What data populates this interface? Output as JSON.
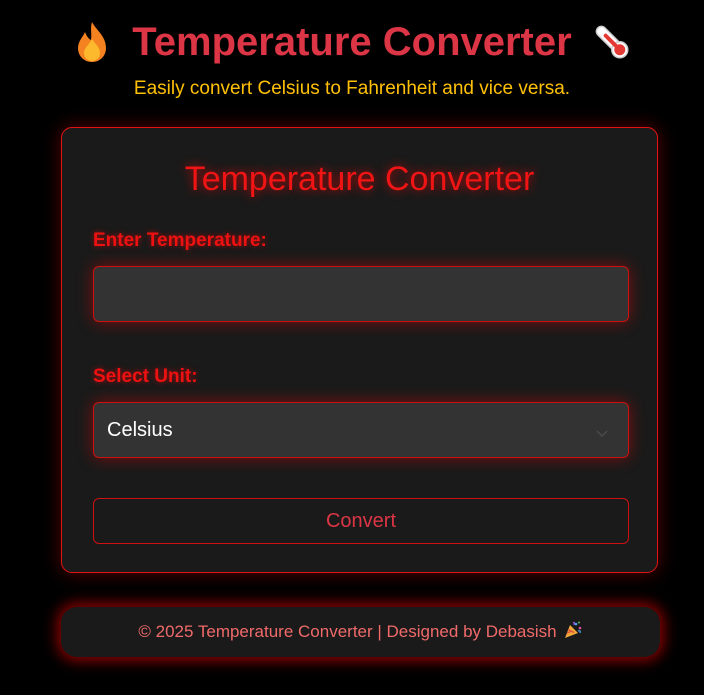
{
  "header": {
    "title": "Temperature Converter",
    "title_left_icon": "fire-icon",
    "title_right_icon": "thermometer-icon",
    "subtitle": "Easily convert Celsius to Fahrenheit and vice versa."
  },
  "card": {
    "title": "Temperature Converter",
    "temperature_label": "Enter Temperature:",
    "temperature_value": "",
    "temperature_placeholder": "",
    "unit_label": "Select Unit:",
    "unit_selected": "Celsius",
    "convert_label": "Convert"
  },
  "footer": {
    "text": "© 2025 Temperature Converter | Designed by Debasish",
    "icon": "party-popper-icon"
  },
  "colors": {
    "background": "#000000",
    "title": "#dc3545",
    "subtitle": "#ffc107",
    "accent_red": "#ee1111",
    "card_background": "#1a1a1a",
    "input_background": "#333333",
    "footer_text": "#f06a6a"
  }
}
